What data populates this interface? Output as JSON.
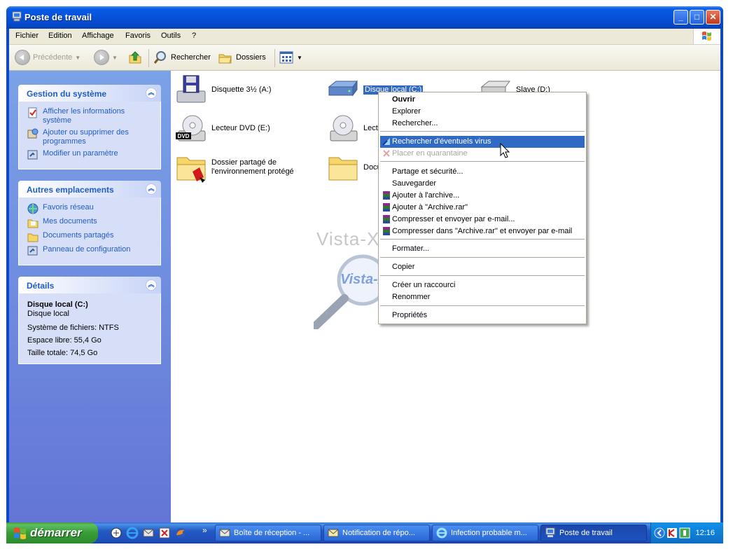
{
  "window": {
    "title": "Poste de travail",
    "minimize_label": "_",
    "maximize_label": "□",
    "close_label": "✕"
  },
  "menubar": [
    "Fichier",
    "Edition",
    "Affichage",
    "Favoris",
    "Outils",
    "?"
  ],
  "toolbar": {
    "back": "Précédente",
    "search": "Rechercher",
    "folders": "Dossiers"
  },
  "panels": {
    "system": {
      "title": "Gestion du système",
      "items": [
        "Afficher les informations système",
        "Ajouter ou supprimer des programmes",
        "Modifier un paramètre"
      ]
    },
    "places": {
      "title": "Autres emplacements",
      "items": [
        "Favoris réseau",
        "Mes documents",
        "Documents partagés",
        "Panneau de configuration"
      ]
    },
    "details": {
      "title": "Détails",
      "name": "Disque local (C:)",
      "type": "Disque local",
      "fs": "Système de fichiers: NTFS",
      "free": "Espace libre: 55,4 Go",
      "total": "Taille totale: 74,5 Go"
    }
  },
  "content": {
    "items": [
      "Disquette 3½ (A:)",
      "Disque local (C:)",
      "Slave (D:)",
      "Lecteur DVD (E:)",
      "Lect",
      "Dossier partagé de l'environnement protégé",
      "Docu"
    ]
  },
  "context_menu": {
    "items": [
      "Ouvrir",
      "Explorer",
      "Rechercher...",
      "Rechercher d'éventuels virus",
      "Placer en quarantaine",
      "Partage et sécurité...",
      "Sauvegarder",
      "Ajouter à l'archive...",
      "Ajouter à \"Archive.rar\"",
      "Compresser et envoyer par e-mail...",
      "Compresser dans \"Archive.rar\" et envoyer par e-mail",
      "Formater...",
      "Copier",
      "Créer un raccourci",
      "Renommer",
      "Propriétés"
    ]
  },
  "watermark": {
    "text1": "Vista-XP.fr",
    "text2": "Vista-XP.fr"
  },
  "taskbar": {
    "start": "démarrer",
    "expand": "»",
    "tasks": [
      "Boîte de réception - ...",
      "Notification de répo...",
      "Infection probable m...",
      "Poste de travail"
    ],
    "clock": "12:16"
  },
  "colors": {
    "title_blue": "#0a5ae6",
    "selection": "#316ac5",
    "task_link": "#215dc6",
    "start_green": "#379c37"
  },
  "icons": [
    "computer-icon",
    "back-icon",
    "forward-icon",
    "up-folder-icon",
    "search-icon",
    "folders-icon",
    "views-icon",
    "floppy-icon",
    "hard-drive-icon",
    "dvd-drive-icon",
    "folder-icon",
    "windows-flag-icon",
    "firefox-icon",
    "ie-icon",
    "antivirus-icon",
    "winrar-icon"
  ]
}
